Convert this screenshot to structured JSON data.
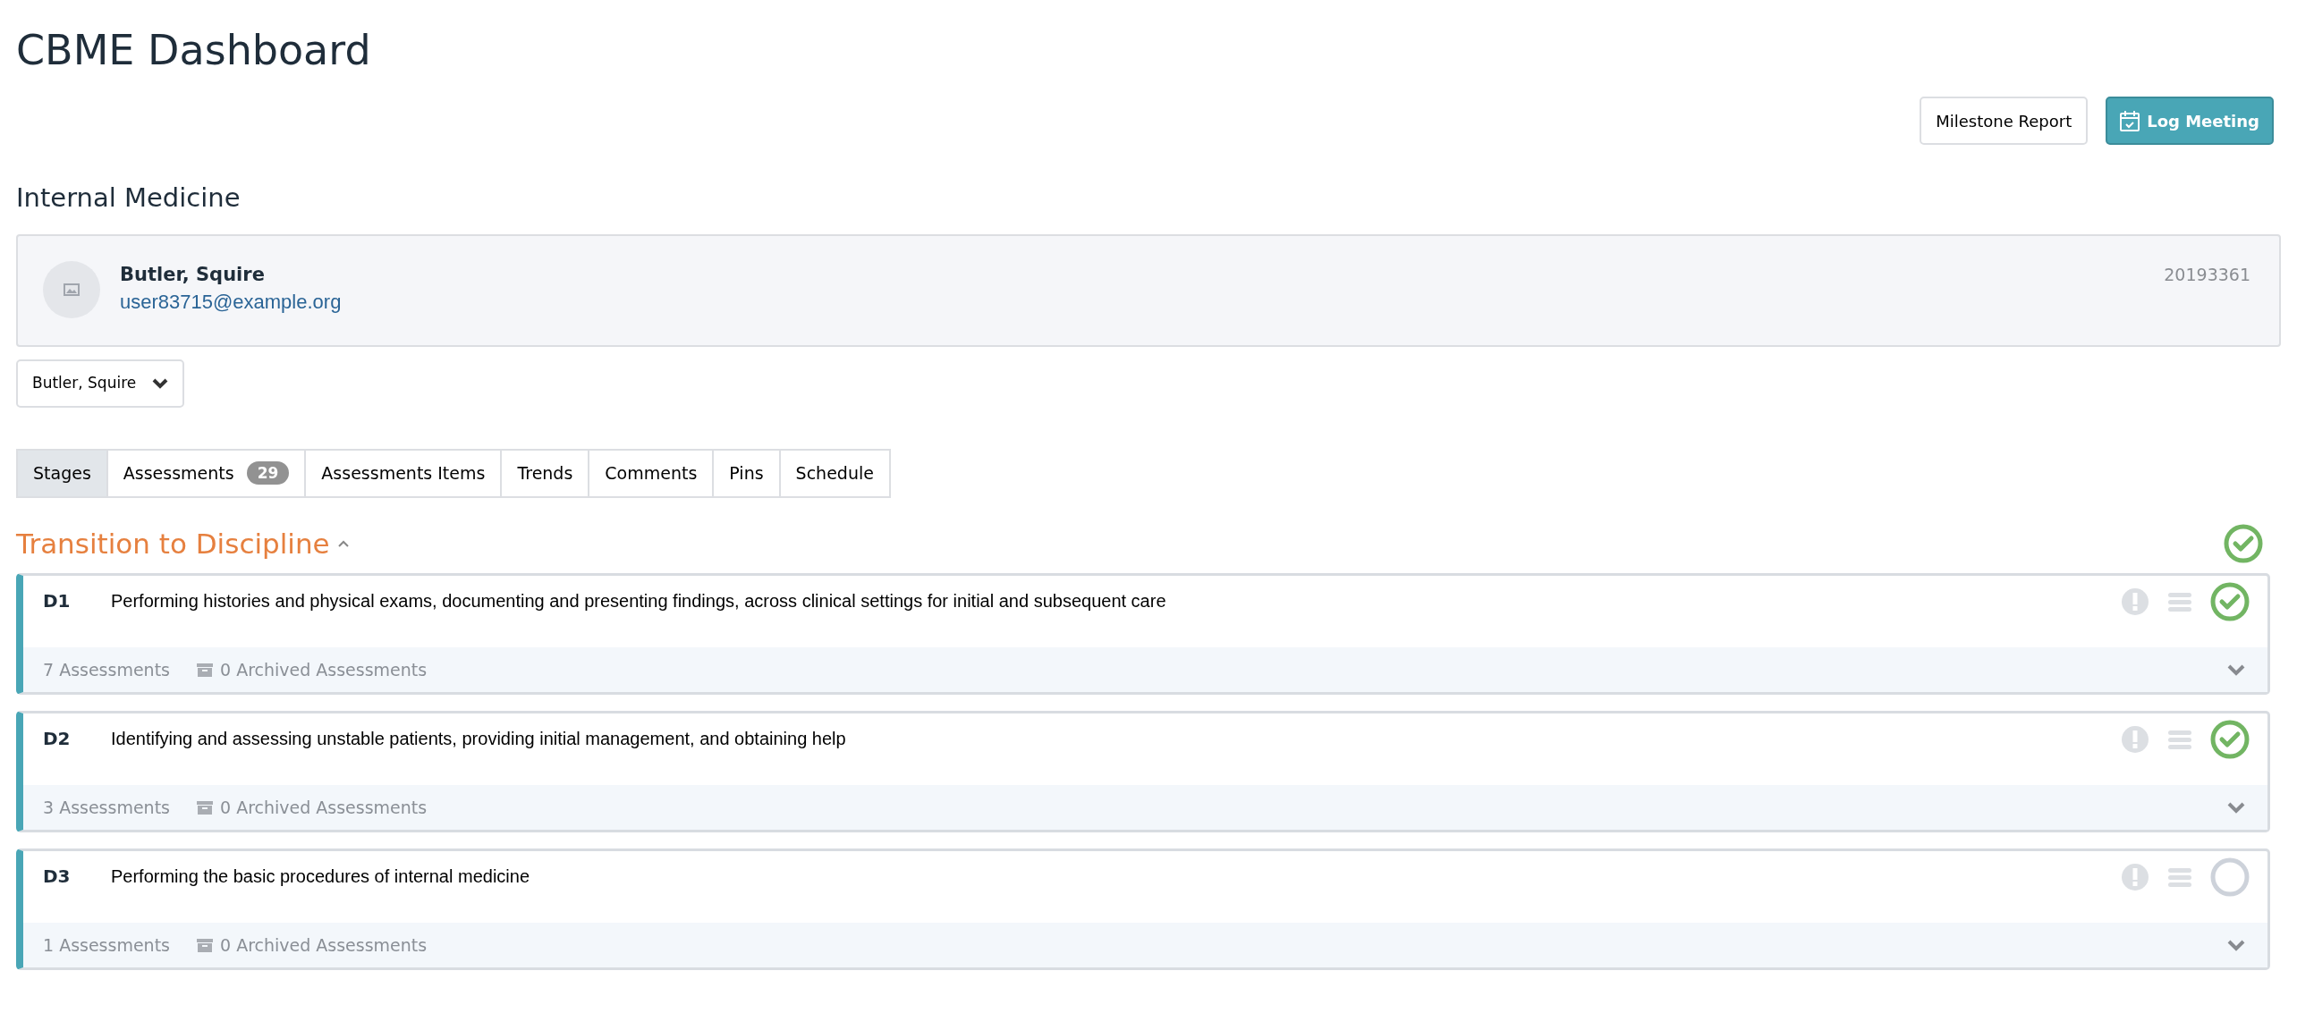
{
  "page_title": "CBME Dashboard",
  "actions": [
    {
      "kind": "plain",
      "label": "Milestone Report"
    },
    {
      "kind": "primary",
      "label": "Log Meeting"
    }
  ],
  "program": "Internal Medicine",
  "learner": {
    "name": "Butler, Squire",
    "email": "user83715@example.org",
    "number": "20193361"
  },
  "learner_select": {
    "value": "Butler, Squire"
  },
  "tabs": [
    {
      "label": "Stages",
      "selected": true
    },
    {
      "label": "Assessments",
      "count": "29",
      "selected": false
    },
    {
      "label": "Assessments Items",
      "selected": false
    },
    {
      "label": "Trends",
      "selected": false
    },
    {
      "label": "Comments",
      "selected": false
    },
    {
      "label": "Pins",
      "selected": false
    },
    {
      "label": "Schedule",
      "selected": false
    }
  ],
  "stage": {
    "title": "Transition to Discipline",
    "expanded": true,
    "completed": true,
    "epas": [
      {
        "code": "D1",
        "title": "Performing histories and physical exams, documenting and presenting findings, across clinical settings for initial and subsequent care",
        "assessments": "7 Assessments",
        "archived": "0 Archived Assessments",
        "completed": true
      },
      {
        "code": "D2",
        "title": "Identifying and assessing unstable patients, providing initial management, and obtaining help",
        "assessments": "3 Assessments",
        "archived": "0 Archived Assessments",
        "completed": true
      },
      {
        "code": "D3",
        "title": "Performing the basic procedures of internal medicine",
        "assessments": "1 Assessments",
        "archived": "0 Archived Assessments",
        "completed": false
      }
    ]
  }
}
